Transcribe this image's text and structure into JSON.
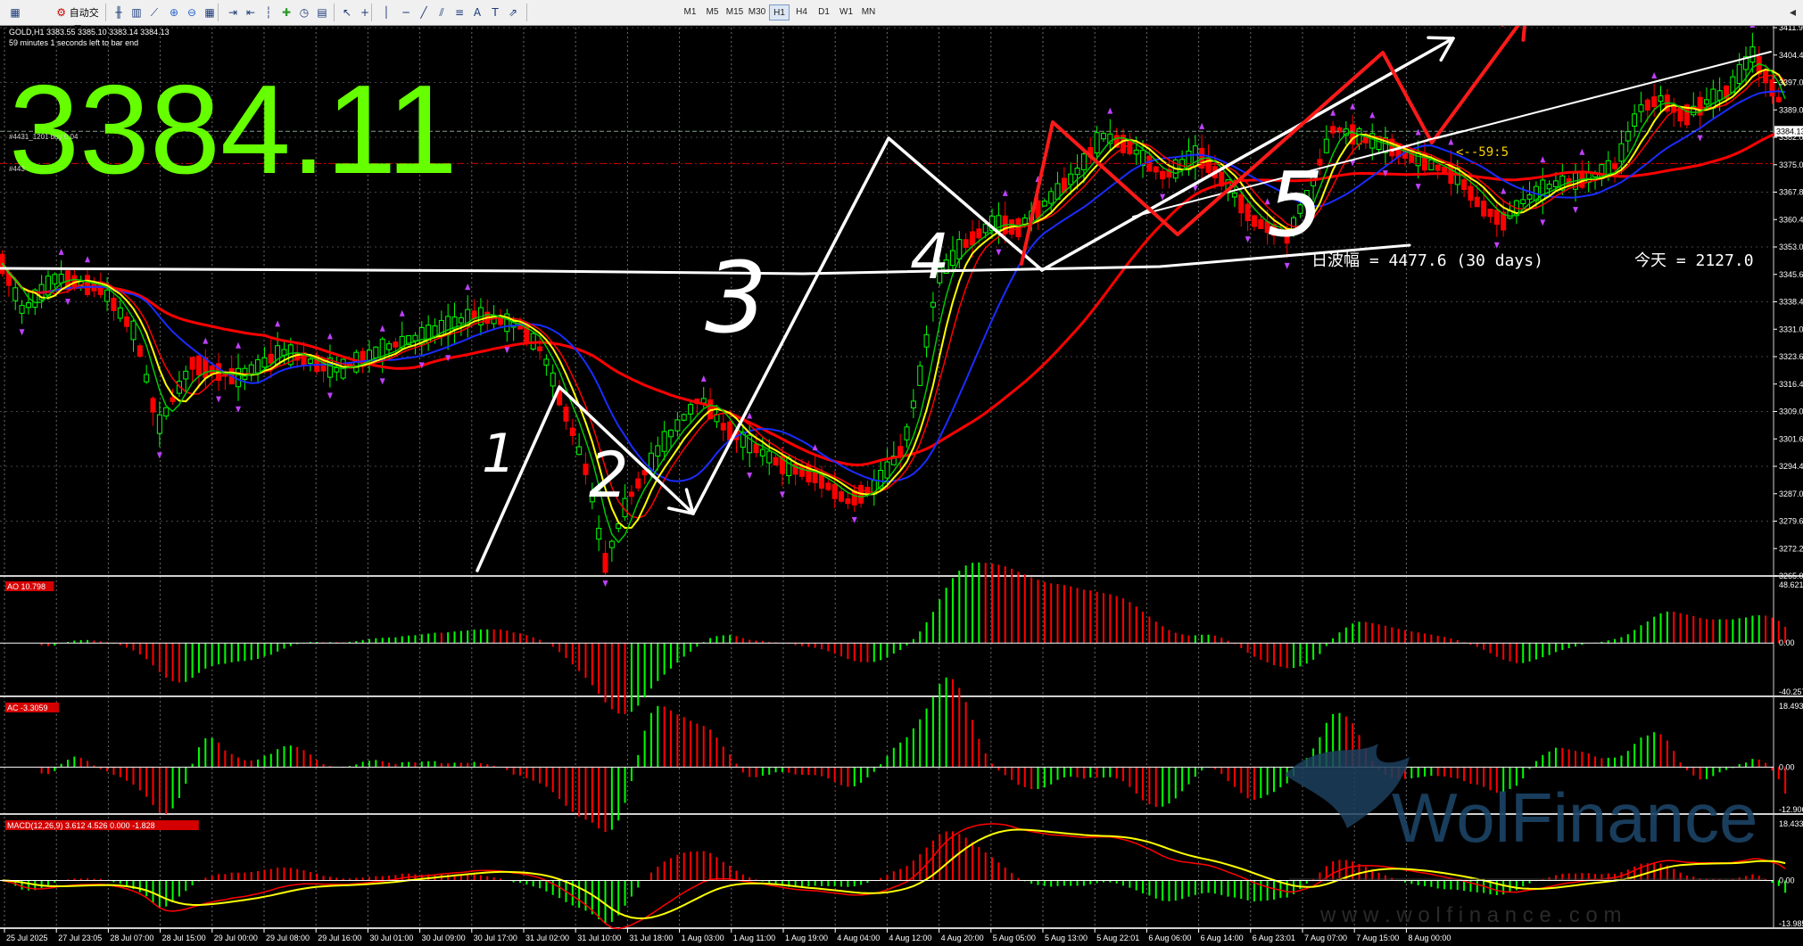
{
  "toolbar": {
    "autotrade_label": "自动交易",
    "timeframes": [
      "M1",
      "M5",
      "M15",
      "M30",
      "H1",
      "H4",
      "D1",
      "W1",
      "MN"
    ],
    "active_timeframe": "H1",
    "buttons": [
      "new-order-icon",
      "autotrade-icon",
      "bar-chart-icon",
      "candles-icon",
      "line-chart-icon",
      "zoom-in-icon",
      "zoom-out-icon",
      "tile-icon",
      "autoscroll-icon",
      "chart-shift-icon",
      "period-sep-icon",
      "indicators-icon",
      "periods-icon",
      "templates-icon",
      "cursor-icon",
      "crosshair-icon",
      "vline-icon",
      "hline-icon",
      "trendline-icon",
      "channel-icon",
      "fibo-icon",
      "text-icon",
      "label-icon",
      "arrows-icon"
    ]
  },
  "chart": {
    "header_line1": "GOLD,H1  3383.55 3385.10 3383.14 3384.13",
    "header_line2": "59 minutes 1 seconds left to bar end",
    "big_price": "3384.11",
    "order_line1": "#4431_1201 buy 0.04",
    "order_line2": "#443",
    "range_text": "日波幅 = 4477.6   (30 days)",
    "today_text": "今天 = 2127.0",
    "countdown": "<--59:5",
    "current_price_label": "3384.13",
    "price_axis": [
      "3411.90",
      "3404.40",
      "3397.00",
      "3389.00",
      "3382.00",
      "3375.00",
      "3367.80",
      "3360.40",
      "3353.00",
      "3345.60",
      "3338.40",
      "3331.00",
      "3323.60",
      "3316.40",
      "3309.00",
      "3301.60",
      "3294.40",
      "3287.00",
      "3279.60",
      "3272.20",
      "3265.00"
    ],
    "time_axis": [
      "25 Jul 2025",
      "27 Jul 23:05",
      "28 Jul 07:00",
      "28 Jul 15:00",
      "29 Jul 00:00",
      "29 Jul 08:00",
      "29 Jul 16:00",
      "30 Jul 01:00",
      "30 Jul 09:00",
      "30 Jul 17:00",
      "31 Jul 02:00",
      "31 Jul 10:00",
      "31 Jul 18:00",
      "1 Aug 03:00",
      "1 Aug 11:00",
      "1 Aug 19:00",
      "4 Aug 04:00",
      "4 Aug 12:00",
      "4 Aug 20:00",
      "5 Aug 05:00",
      "5 Aug 13:00",
      "5 Aug 22:01",
      "6 Aug 06:00",
      "6 Aug 14:00",
      "6 Aug 23:01",
      "7 Aug 07:00",
      "7 Aug 15:00",
      "8 Aug 00:00"
    ],
    "wave_labels": [
      "1",
      "2",
      "3",
      "4",
      "5"
    ]
  },
  "panels": {
    "ao": {
      "label": "AO 10.798",
      "top": "48.621",
      "zero": "0.00",
      "bottom": "-40.257"
    },
    "ac": {
      "label": "AC -3.3059",
      "top": "18.4937",
      "zero": "0.00",
      "bottom": "-12.9069"
    },
    "macd": {
      "label": "MACD(12,26,9) 3.612 4.526 0.000 -1.828",
      "top": "18.433",
      "zero": "0.00",
      "bottom": "-13.985"
    }
  },
  "watermark": {
    "brand": "WolFinance",
    "url": "w w w . w o l f i n a n c e . c o m"
  },
  "colors": {
    "bull": "#00ff00",
    "bear": "#ff0000",
    "background": "#000000",
    "big_price": "#66ff00",
    "ma_red": "#ff0000",
    "ma_blue": "#1a2cff",
    "ma_yellow": "#ffff00",
    "ma_green": "#00c800"
  }
}
